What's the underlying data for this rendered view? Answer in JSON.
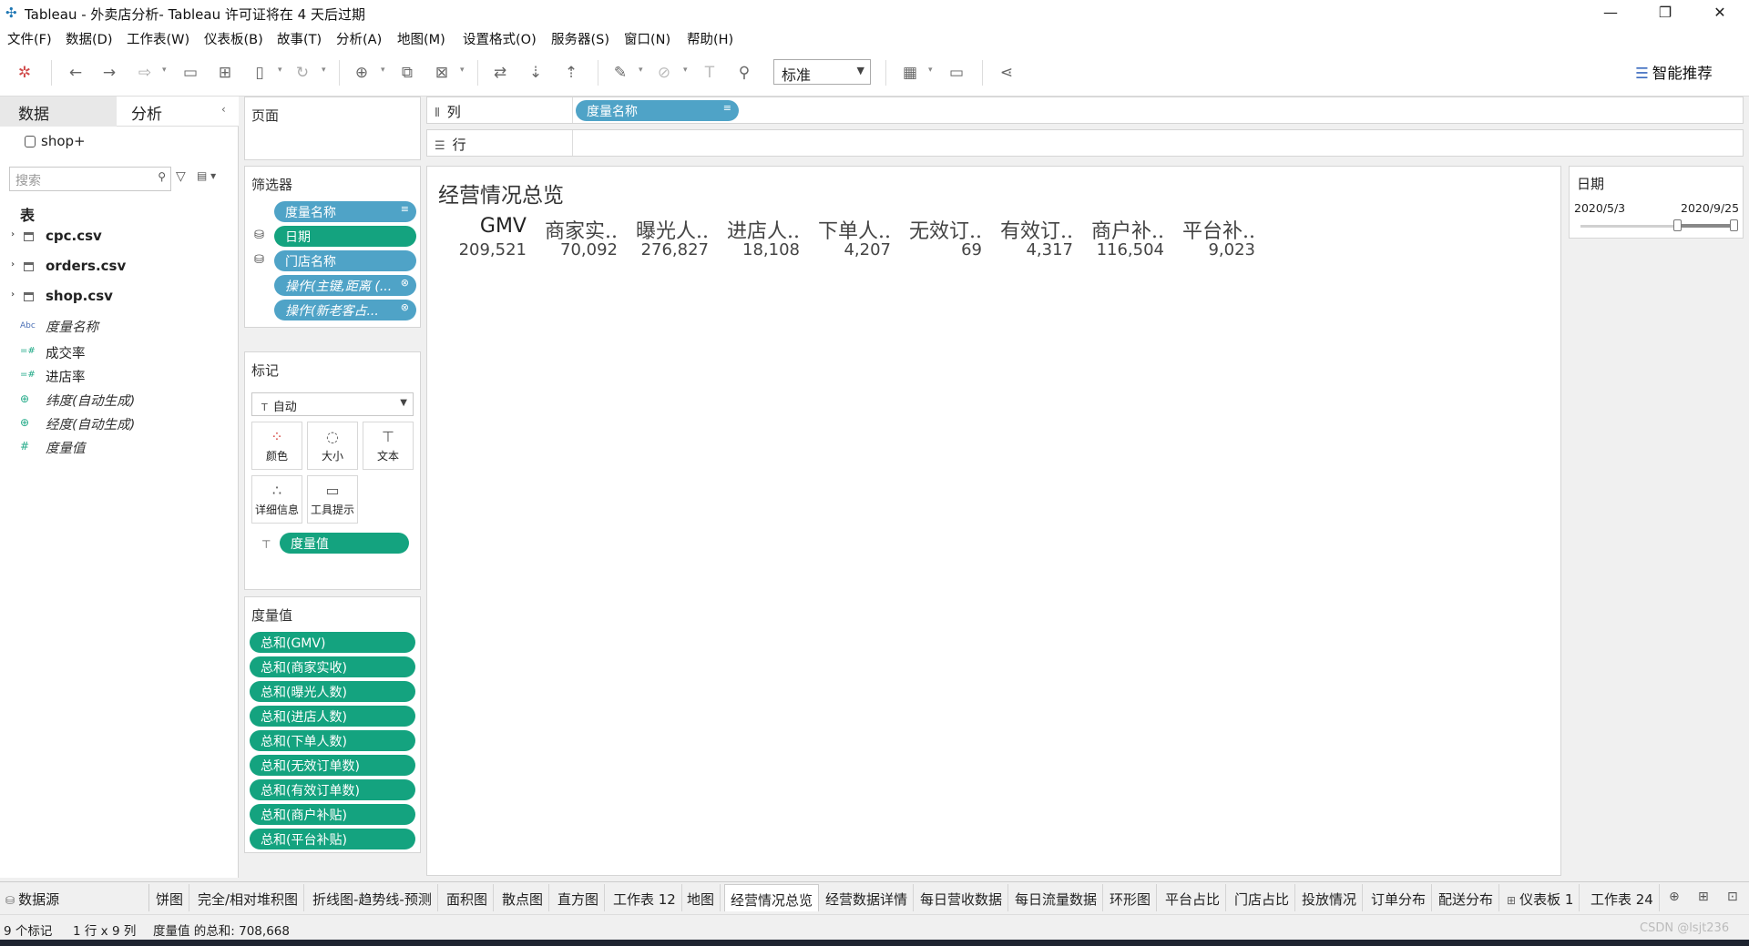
{
  "window": {
    "title": "Tableau - 外卖店分析- Tableau 许可证将在 4 天后过期",
    "minimize": "—",
    "restore": "❐",
    "close": "✕"
  },
  "menu": [
    "文件(F)",
    "数据(D)",
    "工作表(W)",
    "仪表板(B)",
    "故事(T)",
    "分析(A)",
    "地图(M)",
    "设置格式(O)",
    "服务器(S)",
    "窗口(N)",
    "帮助(H)"
  ],
  "toolbar": {
    "fit_value": "标准",
    "smart_label": "智能推荐"
  },
  "data_pane": {
    "tab_data": "数据",
    "tab_analysis": "分析",
    "datasource": "shop+",
    "search_placeholder": "搜索",
    "tables_heading": "表",
    "tables": [
      "cpc.csv",
      "orders.csv",
      "shop.csv"
    ],
    "fields": [
      {
        "label": "度量名称",
        "icon": "Abc",
        "italic": true
      },
      {
        "label": "成交率",
        "icon": "=#",
        "italic": false
      },
      {
        "label": "进店率",
        "icon": "=#",
        "italic": false
      },
      {
        "label": "纬度(自动生成)",
        "icon": "globe",
        "italic": true
      },
      {
        "label": "经度(自动生成)",
        "icon": "globe",
        "italic": true
      },
      {
        "label": "度量值",
        "icon": "#",
        "italic": true
      }
    ]
  },
  "pages_title": "页面",
  "filters": {
    "title": "筛选器",
    "items": [
      "度量名称",
      "日期",
      "门店名称",
      "操作(主键,距离 (...",
      "操作(新老客占..."
    ]
  },
  "marks": {
    "title": "标记",
    "type": "自动",
    "buttons": [
      "颜色",
      "大小",
      "文本",
      "详细信息",
      "工具提示"
    ],
    "text_pill": "度量值"
  },
  "measure_values": {
    "title": "度量值",
    "items": [
      "总和(GMV)",
      "总和(商家实收)",
      "总和(曝光人数)",
      "总和(进店人数)",
      "总和(下单人数)",
      "总和(无效订单数)",
      "总和(有效订单数)",
      "总和(商户补贴)",
      "总和(平台补贴)"
    ]
  },
  "columns_shelf": {
    "label": "列",
    "pill": "度量名称"
  },
  "rows_shelf": {
    "label": "行"
  },
  "viz": {
    "title": "经营情况总览",
    "kpis": [
      {
        "header": "GMV",
        "value": "209,521"
      },
      {
        "header": "商家实..",
        "value": "70,092"
      },
      {
        "header": "曝光人..",
        "value": "276,827"
      },
      {
        "header": "进店人..",
        "value": "18,108"
      },
      {
        "header": "下单人..",
        "value": "4,207"
      },
      {
        "header": "无效订..",
        "value": "69"
      },
      {
        "header": "有效订..",
        "value": "4,317"
      },
      {
        "header": "商户补..",
        "value": "116,504"
      },
      {
        "header": "平台补..",
        "value": "9,023"
      }
    ]
  },
  "date_filter": {
    "title": "日期",
    "min": "2020/5/3",
    "max": "2020/9/25",
    "range_start_fraction": 0.64
  },
  "sheet_tabs": {
    "datasource": "数据源",
    "tabs": [
      "饼图",
      "完全/相对堆积图",
      "折线图-趋势线-预测",
      "面积图",
      "散点图",
      "直方图",
      "工作表 12",
      "地图",
      "经营情况总览",
      "经营数据详情",
      "每日营收数据",
      "每日流量数据",
      "环形图",
      "平台占比",
      "门店占比",
      "投放情况",
      "订单分布",
      "配送分布",
      "仪表板 1",
      "工作表 24"
    ],
    "active": "经营情况总览"
  },
  "status": {
    "marks": "9 个标记",
    "dims": "1 行 x 9 列",
    "sum": "度量值 的总和: 708,668"
  },
  "watermark": "CSDN @lsjt236"
}
